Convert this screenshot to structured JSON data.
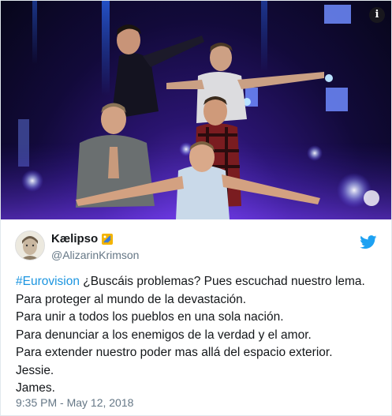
{
  "media": {
    "info_glyph": "i",
    "icon": "info-icon"
  },
  "author": {
    "display_name": "Kælipso",
    "name_emoji": "wind-chime-emoji",
    "handle": "@AlizarinKrimson",
    "avatar": "avatar-image"
  },
  "platform_icon": "twitter-bird-icon",
  "tweet": {
    "hashtag": "#Eurovision",
    "first_line_rest": " ¿Buscáis problemas? Pues escuchad nuestro lema.",
    "lines": [
      "Para proteger al mundo de la devastación.",
      "Para unir a todos los pueblos en una sola nación.",
      "Para denunciar a los enemigos de la verdad y el amor.",
      "Para extender nuestro poder mas allá del espacio exterior.",
      "Jessie.",
      "James."
    ],
    "timestamp": "9:35 PM - May 12, 2018"
  },
  "colors": {
    "link": "#1b95e0",
    "text": "#14171a",
    "muted": "#657786",
    "twitter_blue": "#1da1f2",
    "stage_purple": "#2a1470"
  }
}
